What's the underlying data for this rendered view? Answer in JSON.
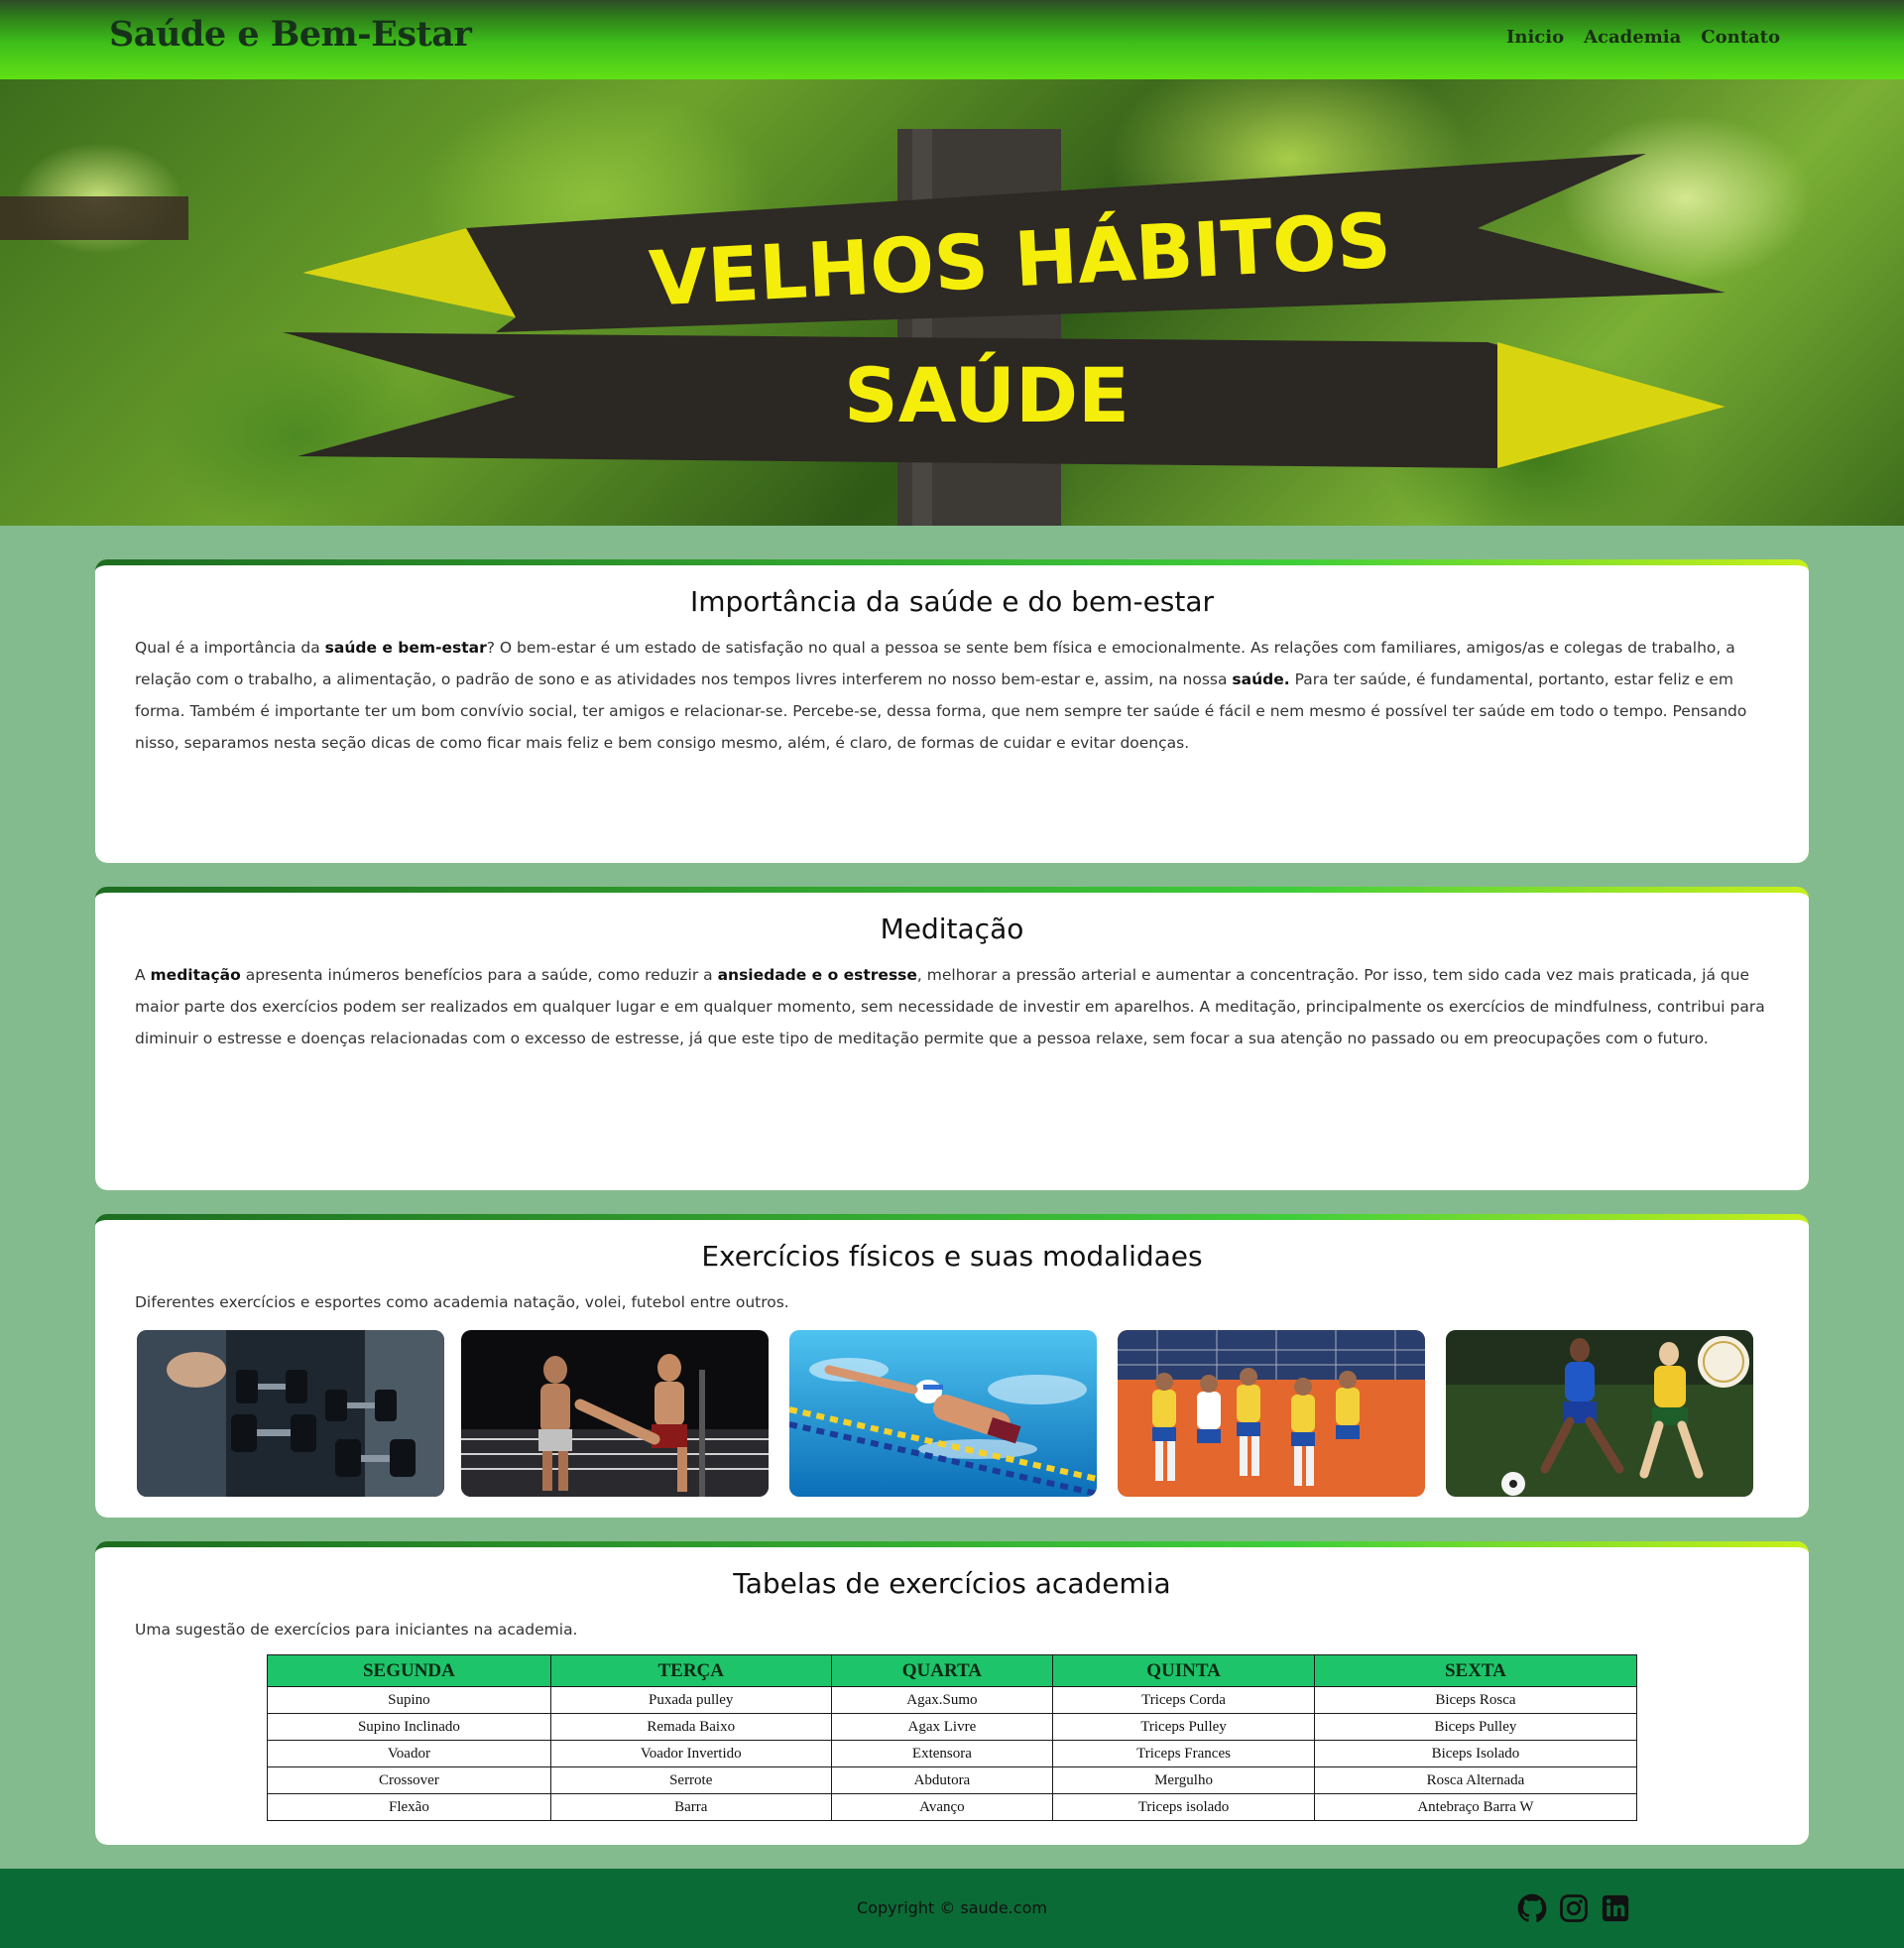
{
  "header": {
    "brand": "Saúde e Bem-Estar",
    "nav": [
      "Inicio",
      "Academia",
      "Contato"
    ]
  },
  "hero": {
    "sign_top": "VELHOS HÁBITOS",
    "sign_bottom": "SAÚDE"
  },
  "sections": [
    {
      "title": "Importância da saúde e do bem-estar",
      "paragraph": [
        {
          "t": "Qual é a importância da "
        },
        {
          "t": "saúde e bem-estar",
          "b": true
        },
        {
          "t": "? O bem-estar é um estado de satisfação no qual a pessoa se sente bem física e emocionalmente. As relações com familiares, amigos/as e colegas de trabalho, a relação com o trabalho, a alimentação, o padrão de sono e as atividades nos tempos livres interferem no nosso bem-estar e, assim, na nossa "
        },
        {
          "t": "saúde.",
          "b": true
        },
        {
          "t": " Para ter saúde, é fundamental, portanto, estar feliz e em forma. Também é importante ter um bom convívio social, ter amigos e relacionar-se. Percebe-se, dessa forma, que nem sempre ter saúde é fácil e nem mesmo é possível ter saúde em todo o tempo. Pensando nisso, separamos nesta seção dicas de como ficar mais feliz e bem consigo mesmo, além, é claro, de formas de cuidar e evitar doenças."
        }
      ]
    },
    {
      "title": "Meditação",
      "paragraph": [
        {
          "t": "A "
        },
        {
          "t": "meditação",
          "b": true
        },
        {
          "t": " apresenta inúmeros benefícios para a saúde, como reduzir a "
        },
        {
          "t": "ansiedade e o estresse",
          "b": true
        },
        {
          "t": ", melhorar a pressão arterial e aumentar a concentração. Por isso, tem sido cada vez mais praticada, já que maior parte dos exercícios podem ser realizados em qualquer lugar e em qualquer momento, sem necessidade de investir em aparelhos. A meditação, principalmente os exercícios de mindfulness, contribui para diminuir o estresse e doenças relacionadas com o excesso de estresse, já que este tipo de meditação permite que a pessoa relaxe, sem focar a sua atenção no passado ou em preocupações com o futuro."
        }
      ]
    },
    {
      "title": "Exercícios físicos e suas modalidaes",
      "paragraph": [
        {
          "t": "Diferentes exercícios e esportes como academia natação, volei, futebol entre outros."
        }
      ],
      "images": [
        "dumbbells-photo",
        "kickboxing-photo",
        "swimming-photo",
        "volleyball-photo",
        "football-photo"
      ]
    },
    {
      "title": "Tabelas de exercícios academia",
      "paragraph": [
        {
          "t": "Uma sugestão de exercícios para iniciantes na academia."
        }
      ]
    }
  ],
  "table": {
    "headers": [
      "SEGUNDA",
      "TERÇA",
      "QUARTA",
      "QUINTA",
      "SEXTA"
    ],
    "rows": [
      [
        "Supino",
        "Puxada pulley",
        "Agax.Sumo",
        "Triceps Corda",
        "Biceps Rosca"
      ],
      [
        "Supino Inclinado",
        "Remada Baixo",
        "Agax Livre",
        "Triceps Pulley",
        "Biceps Pulley"
      ],
      [
        "Voador",
        "Voador Invertido",
        "Extensora",
        "Triceps Frances",
        "Biceps Isolado"
      ],
      [
        "Crossover",
        "Serrote",
        "Abdutora",
        "Mergulho",
        "Rosca Alternada"
      ],
      [
        "Flexão",
        "Barra",
        "Avanço",
        "Triceps isolado",
        "Antebraço Barra W"
      ]
    ]
  },
  "footer": {
    "copyright": "Copyright © saude.com",
    "social": [
      "github-icon",
      "instagram-icon",
      "linkedin-icon"
    ]
  },
  "colors": {
    "header_green": "#3fbf1a",
    "page_bg": "#84bb8e",
    "table_header": "#1ec46a",
    "footer_bg": "#0b6b36"
  }
}
